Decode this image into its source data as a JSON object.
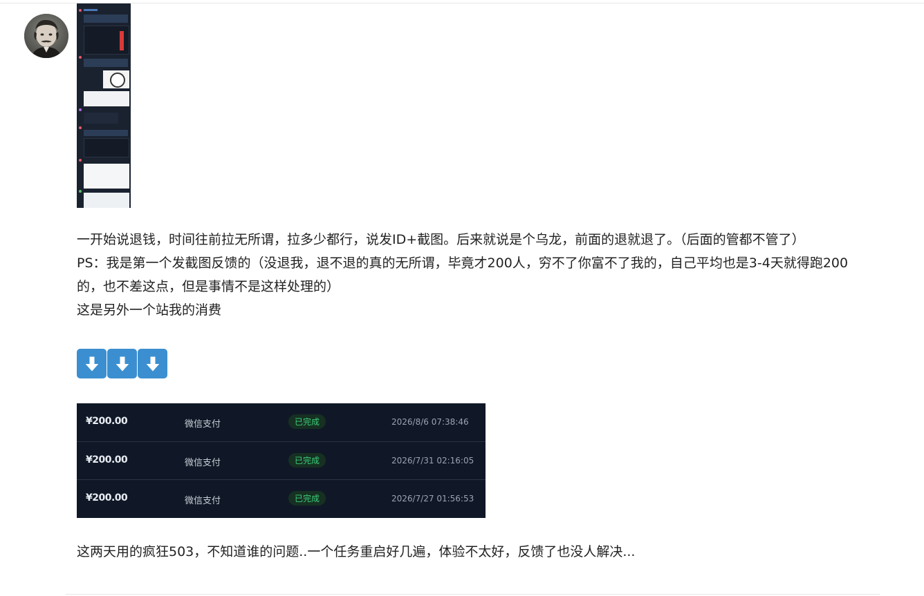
{
  "post": {
    "paragraphs": [
      "一开始说退钱，时间往前拉无所谓，拉多少都行，说发ID+截图。后来就说是个乌龙，前面的退就退了。（后面的管都不管了）",
      "PS：我是第一个发截图反馈的（没退我，退不退的真的无所谓，毕竟才200人，穷不了你富不了我的，自己平均也是3-4天就得跑200的，也不差这点，但是事情不是这样处理的）",
      "这是另外一个站我的消费"
    ],
    "closing": "这两天用的疯狂503，不知道谁的问题..一个任务重启好几遍，体验不太好，反馈了也没人解决..."
  },
  "arrows": [
    "arrow-down-icon",
    "arrow-down-icon",
    "arrow-down-icon"
  ],
  "payments": [
    {
      "amount": "¥200.00",
      "method": "微信支付",
      "status": "已完成",
      "time": "2026/8/6 07:38:46"
    },
    {
      "amount": "¥200.00",
      "method": "微信支付",
      "status": "已完成",
      "time": "2026/7/31 02:16:05"
    },
    {
      "amount": "¥200.00",
      "method": "微信支付",
      "status": "已完成",
      "time": "2026/7/27 01:56:53"
    }
  ],
  "colors": {
    "arrow_bg": "#3b8fd0",
    "table_bg": "#101827",
    "status_green": "#3ccf7a"
  }
}
